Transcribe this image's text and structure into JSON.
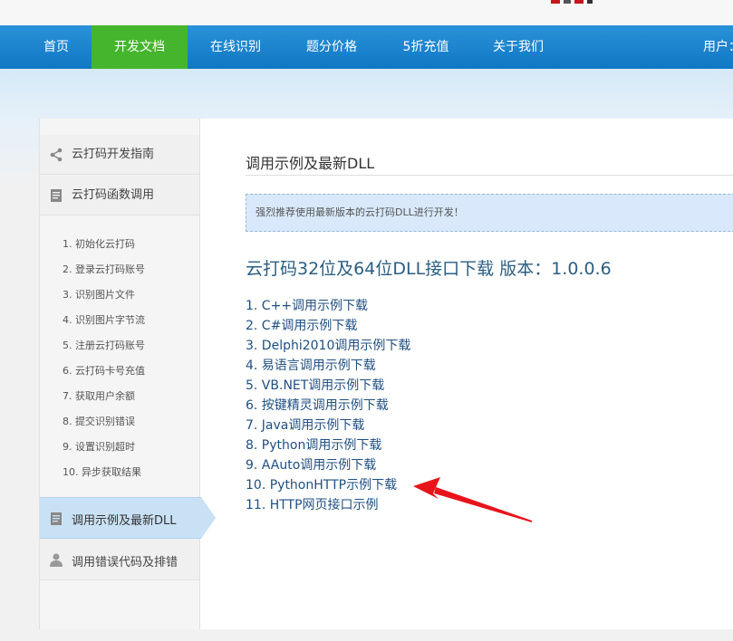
{
  "nav": {
    "items": [
      {
        "label": "首页"
      },
      {
        "label": "开发文档"
      },
      {
        "label": "在线识别"
      },
      {
        "label": "题分价格"
      },
      {
        "label": "5折充值"
      },
      {
        "label": "关于我们"
      }
    ],
    "active_index": 1,
    "user_label": "用户："
  },
  "sidebar": {
    "guide": "云打码开发指南",
    "functions": "云打码函数调用",
    "sub_items": [
      "1. 初始化云打码",
      "2. 登录云打码账号",
      "3. 识别图片文件",
      "4. 识别图片字节流",
      "5. 注册云打码账号",
      "6. 云打码卡号充值",
      "7. 获取用户余额",
      "8. 提交识别错误",
      "9. 设置识别超时",
      "10. 异步获取结果"
    ],
    "active": "调用示例及最新DLL",
    "errors": "调用错误代码及排错"
  },
  "content": {
    "title": "调用示例及最新DLL",
    "notice": "强烈推荐使用最新版本的云打码DLL进行开发！",
    "download_title": "云打码32位及64位DLL接口下载 版本：1.0.0.6",
    "links": [
      "1. C++调用示例下载",
      "2. C#调用示例下载",
      "3. Delphi2010调用示例下载",
      "4. 易语言调用示例下载",
      "5. VB.NET调用示例下载",
      "6. 按键精灵调用示例下载",
      "7. Java调用示例下载",
      "8. Python调用示例下载",
      "9. AAuto调用示例下载",
      "10. PythonHTTP示例下载",
      "11. HTTP网页接口示例"
    ]
  },
  "colors": {
    "nav_bg": "#1a85cf",
    "nav_active": "#45b52d",
    "link": "#1f4f80",
    "arrow_annotation": "#e8141b",
    "sidebar_active": "#c9e1f5"
  },
  "icons": {
    "guide": "share-icon",
    "functions": "document-icon",
    "active": "document-icon",
    "errors": "user-icon"
  }
}
